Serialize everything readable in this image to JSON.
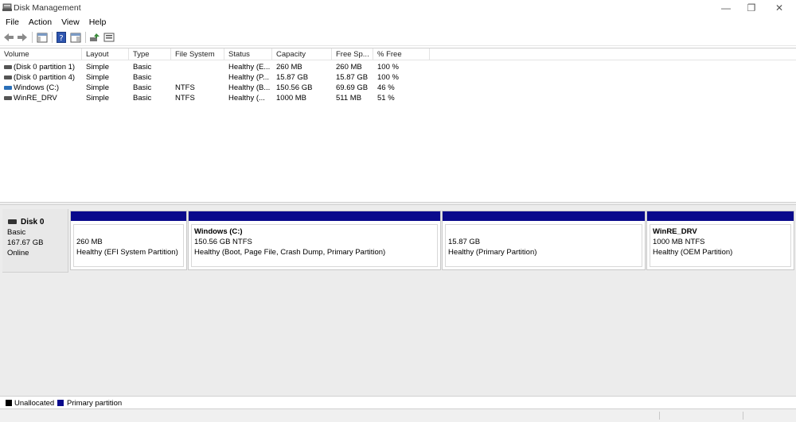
{
  "window": {
    "title": "Disk Management",
    "minimize_glyph": "—",
    "maximize_glyph": "❐",
    "close_glyph": "✕"
  },
  "menu": [
    "File",
    "Action",
    "View",
    "Help"
  ],
  "toolbar": {
    "buttons": [
      "back-arrow-icon",
      "forward-arrow-icon",
      "console-tree-icon",
      "help-icon",
      "properties-icon",
      "rescan-icon",
      "settings-icon"
    ]
  },
  "volume_list": {
    "columns": [
      "Volume",
      "Layout",
      "Type",
      "File System",
      "Status",
      "Capacity",
      "Free Sp...",
      "% Free"
    ],
    "rows": [
      {
        "volume": "(Disk 0 partition 1)",
        "layout": "Simple",
        "type": "Basic",
        "fs": "",
        "status": "Healthy (E...",
        "capacity": "260 MB",
        "free": "260 MB",
        "pct": "100 %",
        "icon_color": "#555555"
      },
      {
        "volume": "(Disk 0 partition 4)",
        "layout": "Simple",
        "type": "Basic",
        "fs": "",
        "status": "Healthy (P...",
        "capacity": "15.87 GB",
        "free": "15.87 GB",
        "pct": "100 %",
        "icon_color": "#555555"
      },
      {
        "volume": "Windows (C:)",
        "layout": "Simple",
        "type": "Basic",
        "fs": "NTFS",
        "status": "Healthy (B...",
        "capacity": "150.56 GB",
        "free": "69.69 GB",
        "pct": "46 %",
        "icon_color": "#2a6fb8"
      },
      {
        "volume": "WinRE_DRV",
        "layout": "Simple",
        "type": "Basic",
        "fs": "NTFS",
        "status": "Healthy (...",
        "capacity": "1000 MB",
        "free": "511 MB",
        "pct": "51 %",
        "icon_color": "#555555"
      }
    ]
  },
  "disk": {
    "name": "Disk 0",
    "type": "Basic",
    "size": "167.67 GB",
    "state": "Online",
    "partitions": [
      {
        "name": "",
        "size": "260 MB",
        "status": "Healthy (EFI System Partition)"
      },
      {
        "name": "Windows  (C:)",
        "size": "150.56 GB NTFS",
        "status": "Healthy (Boot, Page File, Crash Dump, Primary Partition)"
      },
      {
        "name": "",
        "size": "15.87 GB",
        "status": "Healthy (Primary Partition)"
      },
      {
        "name": "WinRE_DRV",
        "size": "1000 MB NTFS",
        "status": "Healthy (OEM Partition)"
      }
    ]
  },
  "legend": {
    "unallocated": "Unallocated",
    "primary": "Primary partition",
    "unallocated_color": "#000000",
    "primary_color": "#0a0a8c"
  }
}
